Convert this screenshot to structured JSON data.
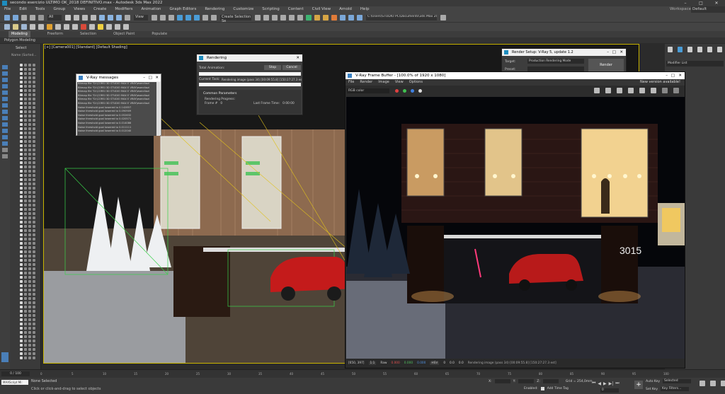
{
  "window": {
    "title": "secondo esercizio ULTIMO OK_2018 DEFINITIVO.max - Autodesk 3ds Max 2022",
    "workspace_label": "Workspaces:",
    "workspace_value": "Default"
  },
  "menu": [
    "File",
    "Edit",
    "Tools",
    "Group",
    "Views",
    "Create",
    "Modifiers",
    "Animation",
    "Graph Editors",
    "Rendering",
    "Customize",
    "Scripting",
    "Content",
    "Civil View",
    "Arnold",
    "Help"
  ],
  "toolbar": {
    "selection_filter": "All",
    "view_dropdown": "View",
    "selection_set": "Create Selection Se",
    "project_path": "C:\\Users\\STUDIO PC\\Documents\\3ds Max 2022"
  },
  "ribbon": {
    "tabs": [
      "Modeling",
      "Freeform",
      "Selection",
      "Object Paint",
      "Populate"
    ],
    "active_tab": "Modeling",
    "sub_label": "Polygon Modeling"
  },
  "scene_explorer": {
    "select_label": "Select",
    "sort_label": "Name (Sorted..."
  },
  "viewport": {
    "label": "[+] [Camera001] [Standard] [Default Shading]"
  },
  "vray_messages": {
    "title": "V-Ray messages",
    "lines": [
      "Bitmap file \"D:\\CORSI 3D STUDIO MAX E VRAY\\esercitazi",
      "Bitmap file \"D:\\CORSI 3D STUDIO MAX E VRAY\\esercitazi",
      "Bitmap file \"D:\\CORSI 3D STUDIO MAX E VRAY\\esercitazi",
      "Bitmap file \"D:\\CORSI 3D STUDIO MAX E VRAY\\esercitazi",
      "Bitmap file \"D:\\CORSI 3D STUDIO MAX E VRAY\\esercitazi",
      "Bitmap file \"D:\\CORSI 3D STUDIO MAX E VRAY\\esercitazi",
      "Noise threshold goal lowered to 0.142857",
      "Noise threshold goal lowered to 0.090909",
      "Noise threshold goal lowered to 0.052632",
      "Noise threshold goal lowered to 0.020571",
      "Noise threshold goal lowered to 0.014086",
      "Noise threshold goal lowered to 0.011111",
      "Noise threshold goal lowered to 0.012040"
    ]
  },
  "rendering_dialog": {
    "title": "Rendering",
    "stop_label": "Stop",
    "cancel_label": "Cancel",
    "total_animation_label": "Total Animation:",
    "current_task_label": "Current Task:",
    "current_task_value": "Rendering image (pass 34) [00:09:55.8] [150:27:27.3 est",
    "common_params_label": "Common Parameters",
    "rendering_progress_label": "Rendering Progress:",
    "frame_label": "Frame #",
    "frame_value": "0",
    "last_frame_time_label": "Last Frame Time:",
    "last_frame_time_value": "0:00:00"
  },
  "render_setup": {
    "title": "Render Setup: V-Ray 5, update 1.2",
    "target_label": "Target:",
    "target_value": "Production Rendering Mode",
    "render_button": "Render",
    "preset_label": "Preset:"
  },
  "frame_buffer": {
    "title": "V-Ray Frame Buffer - [100.0% of 1920 x 1080]",
    "menu": [
      "File",
      "Render",
      "Image",
      "View",
      "Options"
    ],
    "channel": "RGB color",
    "new_version": "New version available!",
    "coords": "[650, 397]",
    "zoom": "1:1",
    "mode": "Raw",
    "r_value": "0.000",
    "g_value": "0.000",
    "b_value": "0.000",
    "color_space": "HSV",
    "h_value": "0",
    "s_value": "0.0",
    "v_value": "0.0",
    "status": "Rendering image (pass 34) [00:09:55.8] [150:27:27.3 est]",
    "house_number": "3015"
  },
  "command_panel": {
    "modifier_list": "Modifier List"
  },
  "timeline": {
    "frame_display": "0 / 100",
    "ticks": [
      "0",
      "5",
      "10",
      "15",
      "20",
      "25",
      "30",
      "35",
      "40",
      "45",
      "50",
      "55",
      "60",
      "65",
      "70",
      "75",
      "80",
      "85",
      "90",
      "95",
      "100"
    ]
  },
  "status": {
    "selection": "None Selected",
    "prompt": "Click or click-and-drag to select objects",
    "maxscript": "MAXScript Mi:",
    "grid": "Grid = 254,0mm",
    "x_label": "X:",
    "y_label": "Y:",
    "z_label": "Z:",
    "enabled_label": "Enabled:",
    "add_time_tag": "Add Time Tag",
    "auto_key": "Auto Key",
    "set_key": "Set Key",
    "key_filters": "Key Filters...",
    "selected_value": "Selected",
    "frame_value": "0"
  }
}
